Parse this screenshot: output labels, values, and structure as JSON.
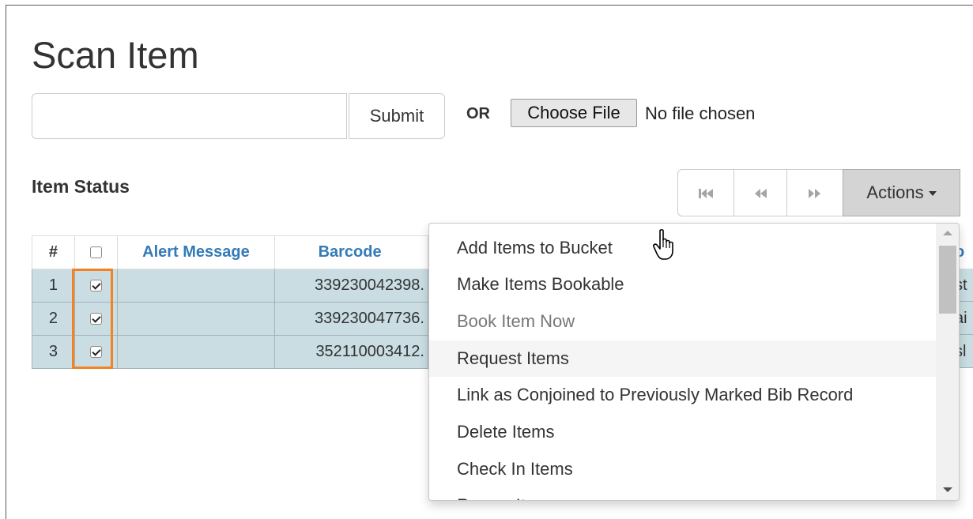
{
  "page": {
    "title": "Scan Item"
  },
  "scan": {
    "input_value": "",
    "submit_label": "Submit",
    "or_label": "OR",
    "file_button_label": "Choose File",
    "file_status": "No file chosen"
  },
  "section": {
    "title": "Item Status"
  },
  "pager": {
    "first_icon": "first-page-icon",
    "prev_icon": "prev-page-icon",
    "next_icon": "next-page-icon"
  },
  "actions": {
    "label": "Actions"
  },
  "table": {
    "headers": {
      "num": "#",
      "alert": "Alert Message",
      "barcode": "Barcode"
    },
    "rows": [
      {
        "num": "1",
        "checked": true,
        "alert": "",
        "barcode": "339230042398."
      },
      {
        "num": "2",
        "checked": true,
        "alert": "",
        "barcode": "339230047736."
      },
      {
        "num": "3",
        "checked": true,
        "alert": "",
        "barcode": "352110003412."
      }
    ],
    "truncated_col": {
      "header": "o",
      "cells": [
        "st",
        "ai",
        "sl"
      ]
    }
  },
  "menu": {
    "items": [
      {
        "label": "Add Items to Bucket"
      },
      {
        "label": "Make Items Bookable"
      },
      {
        "label": "Book Item Now",
        "disabled": true
      },
      {
        "label": "Request Items",
        "hover": true
      },
      {
        "label": "Link as Conjoined to Previously Marked Bib Record"
      },
      {
        "label": "Delete Items"
      },
      {
        "label": "Check In Items"
      },
      {
        "label": "Renew Items"
      }
    ]
  },
  "colors": {
    "link": "#337ab7",
    "row_selected": "#c9dde3",
    "highlight": "#f58220",
    "actions_bg": "#d4d4d4"
  }
}
